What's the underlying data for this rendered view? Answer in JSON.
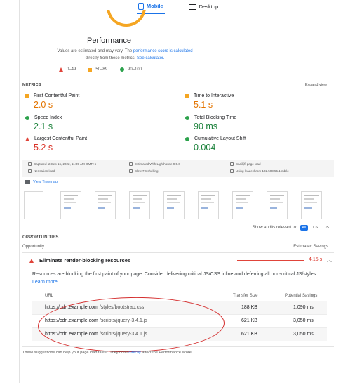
{
  "tabs": {
    "mobile": "Mobile",
    "desktop": "Desktop"
  },
  "performance": {
    "title": "Performance",
    "note_prefix": "Values are estimated and may vary. The",
    "note_link": "performance score is calculated",
    "note_mid": "directly from these metrics.",
    "note_link2": "See calculator.",
    "legend": [
      "0–49",
      "50–89",
      "90–100"
    ]
  },
  "metrics": {
    "header": "METRICS",
    "expand_label": "Expand view",
    "items": [
      {
        "label": "First Contentful Paint",
        "value": "2.0 s",
        "status": "orange"
      },
      {
        "label": "Time to Interactive",
        "value": "5.1 s",
        "status": "orange"
      },
      {
        "label": "Speed Index",
        "value": "2.1 s",
        "status": "green"
      },
      {
        "label": "Total Blocking Time",
        "value": "90 ms",
        "status": "green"
      },
      {
        "label": "Largest Contentful Paint",
        "value": "5.2 s",
        "status": "red"
      },
      {
        "label": "Cumulative Layout Shift",
        "value": "0.004",
        "status": "green"
      }
    ]
  },
  "run_info": {
    "captured": "Captured at Sep 16, 2022, 11:39 AM GMT+5",
    "lighthouse": "Estimated With Lighthouse 9.5.6",
    "load": "Snailýfi page load",
    "emulation": "Nerisation load",
    "throttling": "Slow 7G shelling",
    "ua": "Using leadechrom 102.503.55.1 mbile"
  },
  "treemap_label": "View Treemap",
  "relevant": {
    "label": "Show audits relevant to:",
    "all": "All",
    "cs": "CS",
    "js": "JS"
  },
  "opportunities": {
    "header": "OPPORTUNITIES",
    "col_opportunity": "Opportunity",
    "col_savings": "Estimated Savings",
    "audit_title": "Eliminate render-blocking resources",
    "audit_savings": "4.15 s",
    "description": "Resources are blocking the first paint of your page. Consider delivering critical JS/CSS inline and deferring all non-critical JS/styles.",
    "learn_more": "Learn more",
    "table": {
      "col_url": "URL",
      "col_size": "Transfer Size",
      "col_savings": "Potential Savings",
      "rows": [
        {
          "host": "https://cdn.example.com",
          "path": "/styles/bootstrap.css",
          "size": "188 KB",
          "savings": "1,090 ms"
        },
        {
          "host": "https://cdn.example.com",
          "path": "/scripts/jquery-3.4.1.js",
          "size": "621 KB",
          "savings": "3,050 ms"
        },
        {
          "host": "https://cdn.example.com",
          "path": "/scripts/jquery-3.4.1.js",
          "size": "621 KB",
          "savings": "3,050 ms"
        }
      ]
    }
  },
  "footer": {
    "text_a": "These suggestions can help your page load faster. They don't",
    "link": "directly",
    "text_b": "affect the Performance score."
  },
  "colors": {
    "accent": "#1a73e8",
    "fail": "#e0443a",
    "average": "#f5a623",
    "pass": "#2ca24c",
    "annotation": "#d42e2e"
  }
}
